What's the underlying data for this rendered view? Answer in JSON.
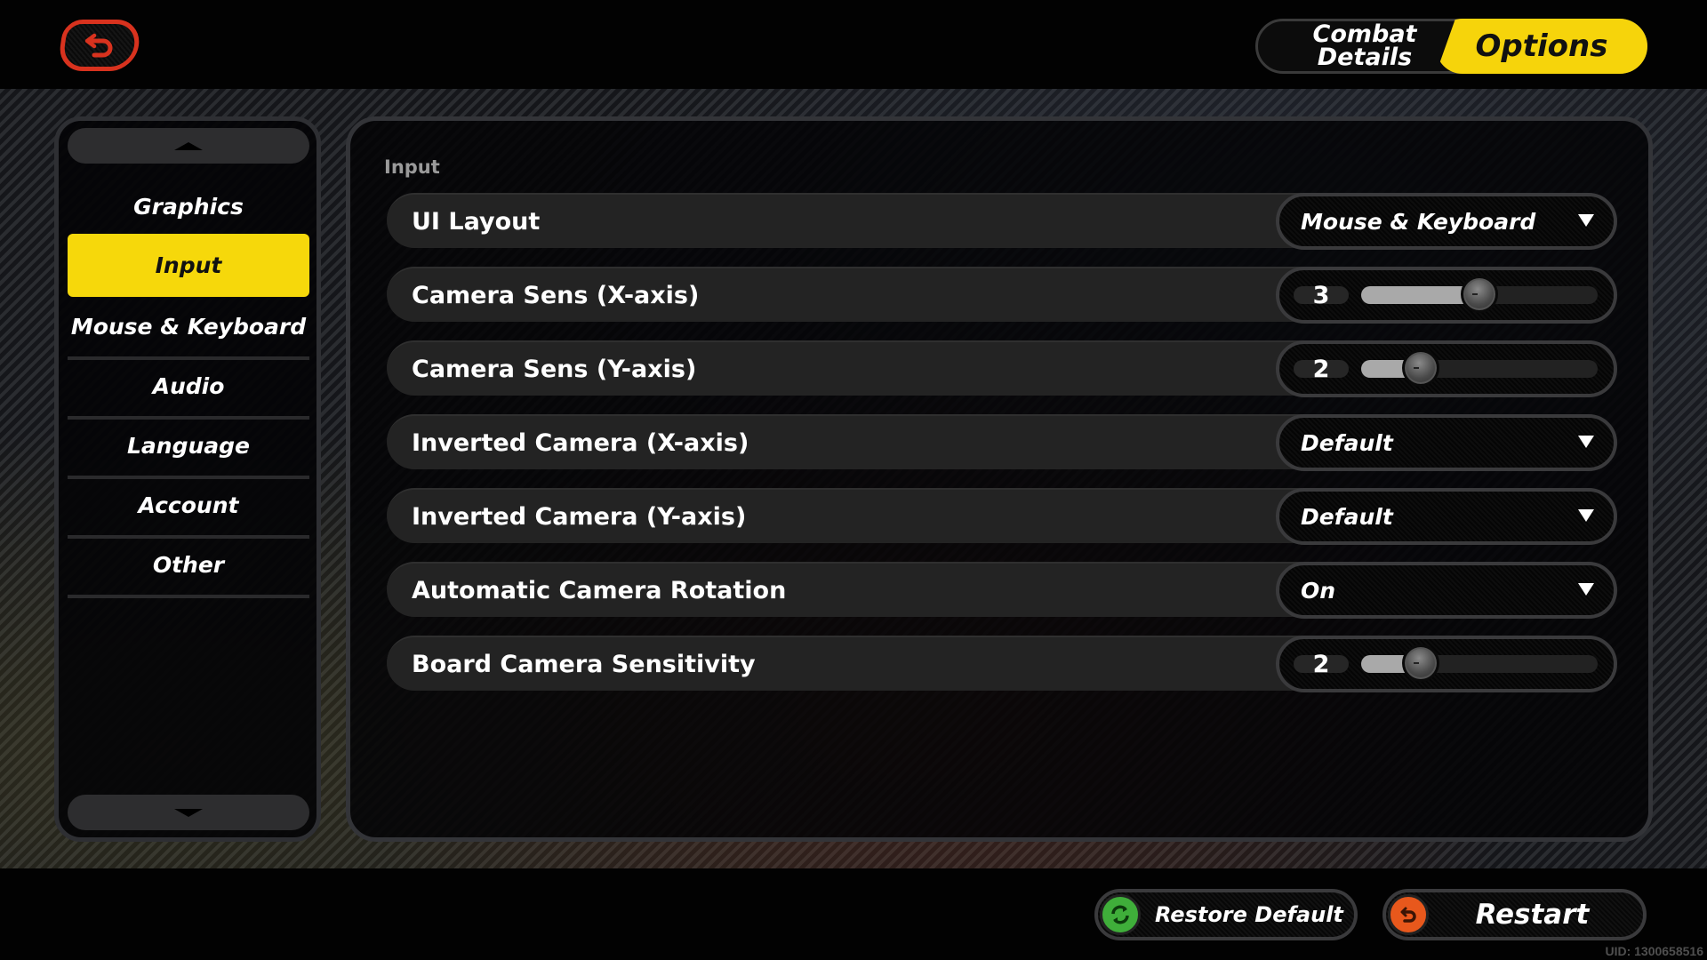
{
  "header": {
    "back_icon": "back-arrow-icon",
    "tabs": [
      {
        "label": "Combat\nDetails",
        "active": false
      },
      {
        "label": "Options",
        "active": true
      }
    ]
  },
  "sidebar": {
    "scroll_up_icon": "chevron-up-icon",
    "scroll_down_icon": "chevron-down-icon",
    "items": [
      {
        "label": "Graphics",
        "active": false
      },
      {
        "label": "Input",
        "active": true
      },
      {
        "label": "Mouse & Keyboard",
        "active": false
      },
      {
        "label": "Audio",
        "active": false
      },
      {
        "label": "Language",
        "active": false
      },
      {
        "label": "Account",
        "active": false
      },
      {
        "label": "Other",
        "active": false
      }
    ]
  },
  "main": {
    "section_title": "Input",
    "settings": [
      {
        "label": "UI Layout",
        "type": "dropdown",
        "value": "Mouse & Keyboard"
      },
      {
        "label": "Camera Sens (X-axis)",
        "type": "slider",
        "value": "3",
        "min": 1,
        "max": 5
      },
      {
        "label": "Camera Sens (Y-axis)",
        "type": "slider",
        "value": "2",
        "min": 1,
        "max": 5
      },
      {
        "label": "Inverted Camera (X-axis)",
        "type": "dropdown",
        "value": "Default"
      },
      {
        "label": "Inverted Camera (Y-axis)",
        "type": "dropdown",
        "value": "Default"
      },
      {
        "label": "Automatic Camera Rotation",
        "type": "dropdown",
        "value": "On"
      },
      {
        "label": "Board Camera Sensitivity",
        "type": "slider",
        "value": "2",
        "min": 1,
        "max": 5
      }
    ]
  },
  "footer": {
    "restore_default_label": "Restore Default",
    "restore_icon": "refresh-icon",
    "restart_label": "Restart",
    "restart_icon": "restart-icon",
    "uid": "UID: 1300658516"
  },
  "colors": {
    "accent_yellow": "#f6d80b",
    "back_red": "#d8321e",
    "restore_green": "#3fae3a",
    "restart_orange": "#e8581c"
  }
}
